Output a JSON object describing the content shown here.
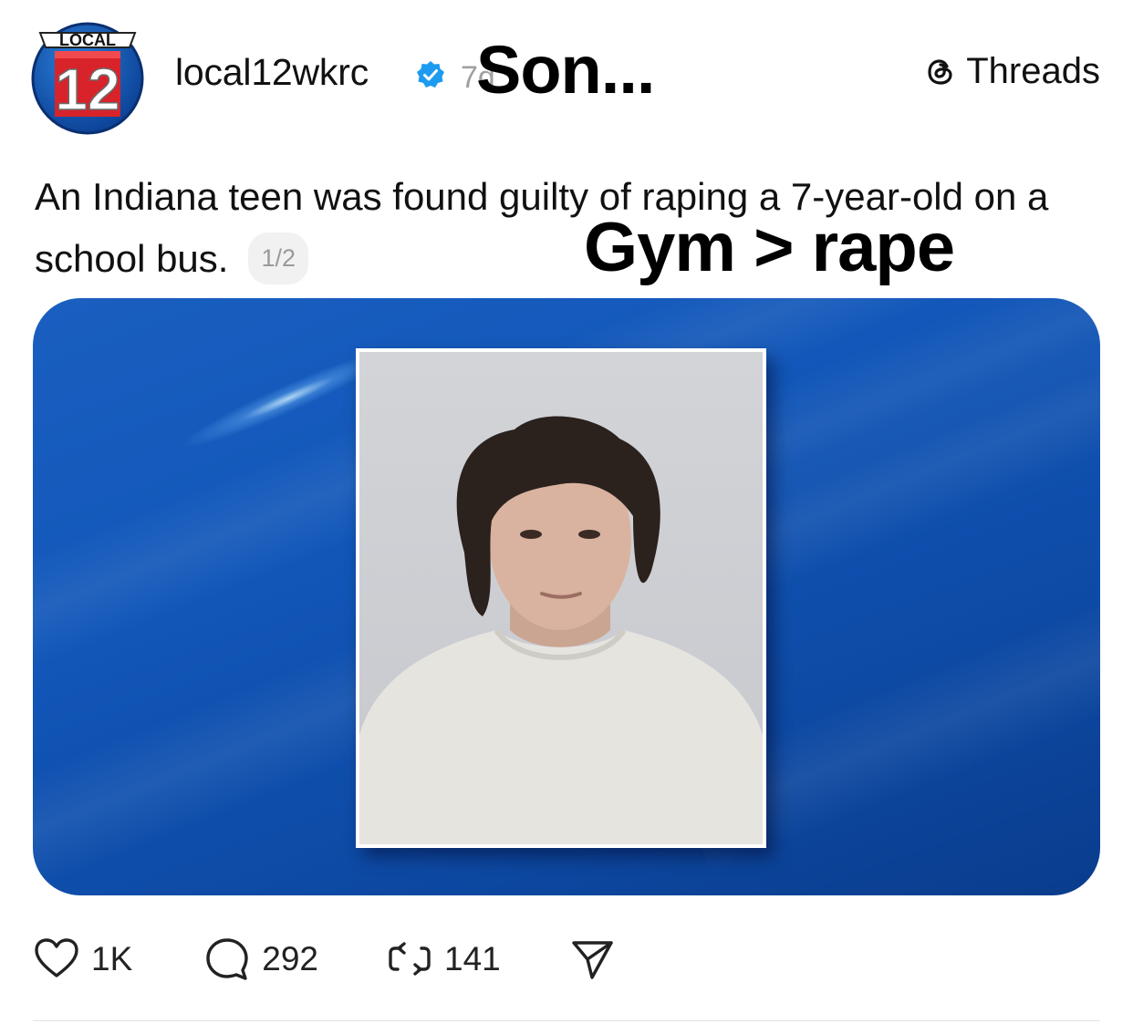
{
  "header": {
    "avatar_text_top": "LOCAL",
    "avatar_text_number": "12",
    "username": "local12wkrc",
    "timestamp": "7d",
    "platform_label": "Threads"
  },
  "overlays": {
    "top_caption": "Son...",
    "middle_caption": "Gym > rape"
  },
  "post": {
    "text": "An Indiana teen was found guilty of raping a 7-year-old on a school bus.",
    "page_indicator": "1/2"
  },
  "actions": {
    "likes": "1K",
    "replies": "292",
    "reposts": "141"
  },
  "colors": {
    "media_background": "#1257b9",
    "verified_badge": "#1d9bf0",
    "logo_red": "#d8232a"
  }
}
